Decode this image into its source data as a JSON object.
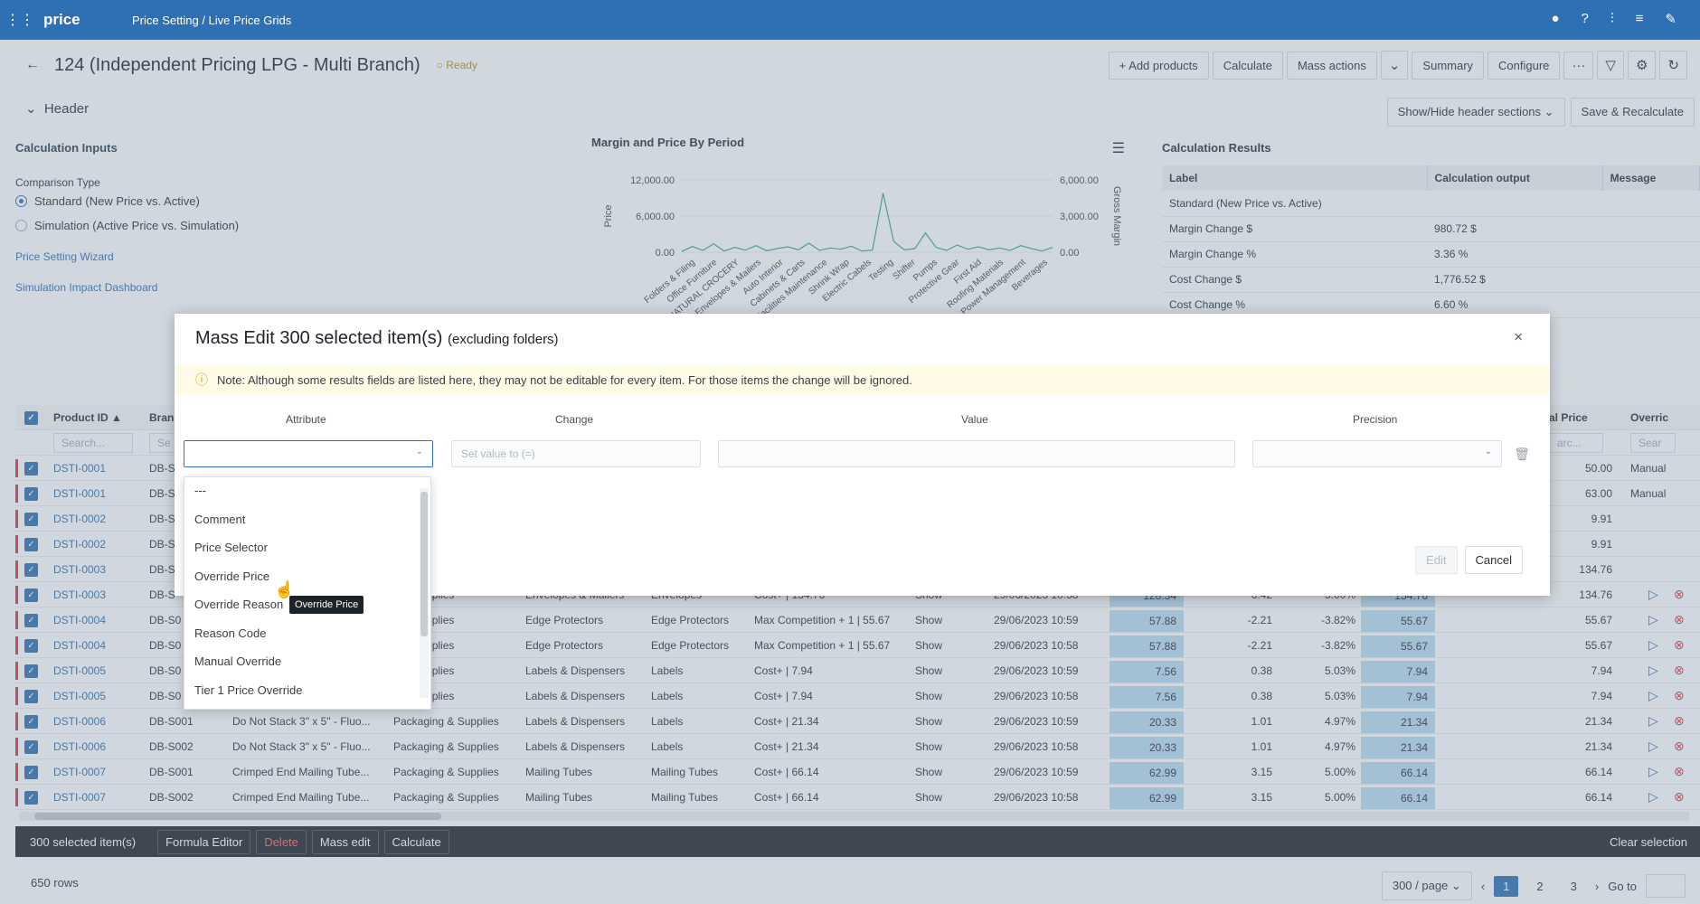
{
  "topbar": {
    "logo": "price",
    "breadcrumb": "Price Setting / Live Price Grids",
    "icons": [
      "notification-icon",
      "help-icon",
      "settings-sliders-icon",
      "database-icon",
      "tools-icon"
    ]
  },
  "titlebar": {
    "title": "124 (Independent Pricing LPG - Multi Branch)",
    "status": "Ready",
    "add_products": "Add products",
    "calculate": "Calculate",
    "mass_actions": "Mass actions",
    "summary": "Summary",
    "configure": "Configure",
    "more": "···"
  },
  "header_section": {
    "title": "Header",
    "show_hide": "Show/Hide header sections",
    "save_recalculate": "Save & Recalculate"
  },
  "calc_inputs": {
    "title": "Calculation Inputs",
    "comparison_label": "Comparison Type",
    "option_standard": "Standard (New Price vs. Active)",
    "option_simulation": "Simulation (Active Price vs. Simulation)",
    "link_wizard": "Price Setting Wizard",
    "link_dashboard": "Simulation Impact Dashboard"
  },
  "chart_data": {
    "type": "line",
    "title": "Margin and Price By Period",
    "ylabel": "Price",
    "y2label": "Gross Margin",
    "ylim": [
      0,
      12000
    ],
    "y2lim": [
      0,
      6000
    ],
    "y_ticks": [
      "12,000.00",
      "6,000.00",
      "0.00"
    ],
    "y2_ticks": [
      "6,000.00",
      "3,000.00",
      "0.00"
    ],
    "categories": [
      "Folders & Filing",
      "Office Furniture",
      "NATURAL CROCERY",
      "Envelopes & Mailers",
      "Auto Interior",
      "Cabinets & Carts",
      "Facilities Maintenance",
      "Shrink Wrap",
      "Electric Cabels",
      "Testing",
      "Shifter",
      "Pumps",
      "Protective Gear",
      "First Aid",
      "Roofing Materials",
      "Power Management",
      "Beverages"
    ],
    "series": [
      {
        "values": [
          120,
          950,
          300,
          1400,
          200,
          800,
          350,
          1100,
          250,
          600,
          900,
          400,
          1500,
          300,
          700,
          500,
          1000,
          200,
          350,
          9800,
          1800,
          400,
          600,
          3200,
          800,
          300,
          1200,
          500,
          900,
          400,
          700,
          300,
          1100,
          600,
          200,
          800
        ]
      }
    ]
  },
  "results": {
    "title": "Calculation Results",
    "columns": [
      "Label",
      "Calculation output",
      "Message"
    ],
    "rows": [
      [
        "Standard (New Price vs. Active)",
        "",
        ""
      ],
      [
        "Margin Change $",
        "980.72 $",
        ""
      ],
      [
        "Margin Change %",
        "3.36 %",
        ""
      ],
      [
        "Cost Change $",
        "1,776.52 $",
        ""
      ],
      [
        "Cost Change %",
        "6.60 %",
        ""
      ]
    ]
  },
  "grid": {
    "col_product_id": "Product ID",
    "col_branch": "Bran",
    "col_price": "al Price",
    "col_override": "Overric",
    "search_placeholder": "Search...",
    "search_short": "Se",
    "search_arc": "arc...",
    "search_sear": "Sear",
    "rows": [
      {
        "id": "DSTI-0001",
        "branch": "DB-S",
        "product": "",
        "category": "",
        "subcategory": "",
        "subsub": "",
        "rule": "",
        "show": "",
        "date": "",
        "v1": "",
        "v2": "",
        "v3": "",
        "v4": "",
        "price": "50.00",
        "override": "Manual"
      },
      {
        "id": "DSTI-0001",
        "branch": "DB-S",
        "product": "",
        "category": "",
        "subcategory": "",
        "subsub": "",
        "rule": "",
        "show": "",
        "date": "",
        "v1": "",
        "v2": "",
        "v3": "",
        "v4": "",
        "price": "63.00",
        "override": "Manual"
      },
      {
        "id": "DSTI-0002",
        "branch": "DB-S",
        "product": "",
        "category": "",
        "subcategory": "",
        "subsub": "",
        "rule": "",
        "show": "",
        "date": "",
        "v1": "",
        "v2": "",
        "v3": "",
        "v4": "",
        "price": "9.91",
        "override": ""
      },
      {
        "id": "DSTI-0002",
        "branch": "DB-S",
        "product": "",
        "category": "",
        "subcategory": "",
        "subsub": "",
        "rule": "",
        "show": "",
        "date": "",
        "v1": "",
        "v2": "",
        "v3": "",
        "v4": "",
        "price": "9.91",
        "override": ""
      },
      {
        "id": "DSTI-0003",
        "branch": "DB-S",
        "product": "",
        "category": "",
        "subcategory": "",
        "subsub": "",
        "rule": "",
        "show": "",
        "date": "",
        "v1": "",
        "v2": "",
        "v3": "",
        "v4": "",
        "price": "134.76",
        "override": ""
      },
      {
        "id": "DSTI-0003",
        "branch": "DB-S",
        "product": "",
        "category": "g & Supplies",
        "subcategory": "Envelopes & Mailers",
        "subsub": "Envelopes",
        "rule": "Cost+ | 134.76",
        "show": "Show",
        "date": "29/06/2023 10:58",
        "v1": "128.34",
        "v2": "6.42",
        "v3": "5.00%",
        "v4": "134.76",
        "price": "134.76",
        "override": ""
      },
      {
        "id": "DSTI-0004",
        "branch": "DB-S0",
        "product": "",
        "category": "g & Supplies",
        "subcategory": "Edge Protectors",
        "subsub": "Edge Protectors",
        "rule": "Max Competition + 1 | 55.67",
        "show": "Show",
        "date": "29/06/2023 10:59",
        "v1": "57.88",
        "v2": "-2.21",
        "v3": "-3.82%",
        "v4": "55.67",
        "price": "55.67",
        "override": ""
      },
      {
        "id": "DSTI-0004",
        "branch": "DB-S0",
        "product": "",
        "category": "g & Supplies",
        "subcategory": "Edge Protectors",
        "subsub": "Edge Protectors",
        "rule": "Max Competition + 1 | 55.67",
        "show": "Show",
        "date": "29/06/2023 10:58",
        "v1": "57.88",
        "v2": "-2.21",
        "v3": "-3.82%",
        "v4": "55.67",
        "price": "55.67",
        "override": ""
      },
      {
        "id": "DSTI-0005",
        "branch": "DB-S0",
        "product": "",
        "category": "g & Supplies",
        "subcategory": "Labels & Dispensers",
        "subsub": "Labels",
        "rule": "Cost+ | 7.94",
        "show": "Show",
        "date": "29/06/2023 10:59",
        "v1": "7.56",
        "v2": "0.38",
        "v3": "5.03%",
        "v4": "7.94",
        "price": "7.94",
        "override": ""
      },
      {
        "id": "DSTI-0005",
        "branch": "DB-S0",
        "product": "",
        "category": "g & Supplies",
        "subcategory": "Labels & Dispensers",
        "subsub": "Labels",
        "rule": "Cost+ | 7.94",
        "show": "Show",
        "date": "29/06/2023 10:58",
        "v1": "7.56",
        "v2": "0.38",
        "v3": "5.03%",
        "v4": "7.94",
        "price": "7.94",
        "override": ""
      },
      {
        "id": "DSTI-0006",
        "branch": "DB-S001",
        "product": "Do Not Stack 3\" x 5\" - Fluo...",
        "category": "Packaging & Supplies",
        "subcategory": "Labels & Dispensers",
        "subsub": "Labels",
        "rule": "Cost+ | 21.34",
        "show": "Show",
        "date": "29/06/2023 10:59",
        "v1": "20.33",
        "v2": "1.01",
        "v3": "4.97%",
        "v4": "21.34",
        "price": "21.34",
        "override": ""
      },
      {
        "id": "DSTI-0006",
        "branch": "DB-S002",
        "product": "Do Not Stack 3\" x 5\" - Fluo...",
        "category": "Packaging & Supplies",
        "subcategory": "Labels & Dispensers",
        "subsub": "Labels",
        "rule": "Cost+ | 21.34",
        "show": "Show",
        "date": "29/06/2023 10:58",
        "v1": "20.33",
        "v2": "1.01",
        "v3": "4.97%",
        "v4": "21.34",
        "price": "21.34",
        "override": ""
      },
      {
        "id": "DSTI-0007",
        "branch": "DB-S001",
        "product": "Crimped End Mailing Tube...",
        "category": "Packaging & Supplies",
        "subcategory": "Mailing Tubes",
        "subsub": "Mailing Tubes",
        "rule": "Cost+ | 66.14",
        "show": "Show",
        "date": "29/06/2023 10:59",
        "v1": "62.99",
        "v2": "3.15",
        "v3": "5.00%",
        "v4": "66.14",
        "price": "66.14",
        "override": ""
      },
      {
        "id": "DSTI-0007",
        "branch": "DB-S002",
        "product": "Crimped End Mailing Tube...",
        "category": "Packaging & Supplies",
        "subcategory": "Mailing Tubes",
        "subsub": "Mailing Tubes",
        "rule": "Cost+ | 66.14",
        "show": "Show",
        "date": "29/06/2023 10:58",
        "v1": "62.99",
        "v2": "3.15",
        "v3": "5.00%",
        "v4": "66.14",
        "price": "66.14",
        "override": ""
      }
    ]
  },
  "selection_bar": {
    "count": "300 selected item(s)",
    "formula_editor": "Formula Editor",
    "delete": "Delete",
    "mass_edit": "Mass edit",
    "calculate": "Calculate",
    "clear": "Clear selection"
  },
  "footer": {
    "rows": "650 rows",
    "page_size": "300 / page",
    "pages": [
      "1",
      "2",
      "3"
    ],
    "goto": "Go to"
  },
  "modal": {
    "title": "Mass Edit 300 selected item(s)",
    "subtitle": "(excluding folders)",
    "note": "Note: Although some results fields are listed here, they may not be editable for every item. For those items the change will be ignored.",
    "col_attribute": "Attribute",
    "col_change": "Change",
    "col_value": "Value",
    "col_precision": "Precision",
    "change_placeholder": "Set value to (=)",
    "edit": "Edit",
    "cancel": "Cancel"
  },
  "dropdown": {
    "options": [
      "---",
      "Comment",
      "Price Selector",
      "Override Price",
      "Override Reason",
      "Reason Code",
      "Manual Override",
      "Tier 1 Price Override"
    ],
    "tooltip": "Override Price"
  }
}
